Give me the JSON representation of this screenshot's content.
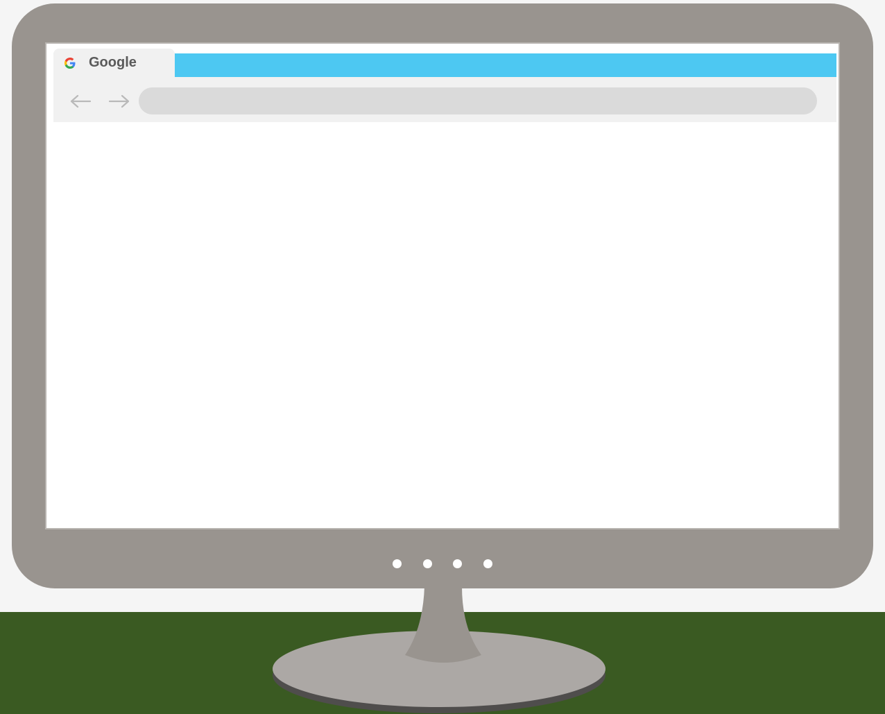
{
  "browser": {
    "tab": {
      "title": "Google",
      "icon": "google-g-icon"
    },
    "toolbar": {
      "back_icon": "arrow-left-icon",
      "forward_icon": "arrow-right-icon",
      "address_value": ""
    }
  },
  "monitor": {
    "indicator_lights": 4
  },
  "colors": {
    "tabbar_accent": "#4dc8f2",
    "monitor_frame": "#99948f",
    "desk": "#3a5a22",
    "wall": "#f5f5f5",
    "stand_base": "#aca8a5"
  }
}
